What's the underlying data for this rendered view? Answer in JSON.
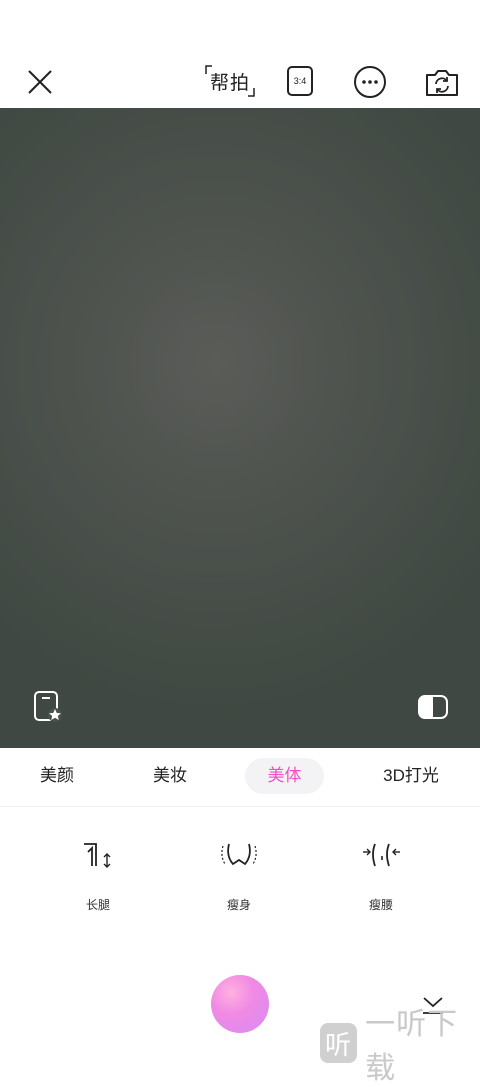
{
  "topbar": {
    "help_label": "帮拍",
    "ratio_label": "3:4",
    "icons": [
      "close-icon",
      "ratio-icon",
      "more-icon",
      "camera-switch-icon"
    ]
  },
  "overlay": {
    "icons": [
      "favorite-frame-icon",
      "compare-icon"
    ]
  },
  "tabs": [
    {
      "label": "美颜",
      "active": false
    },
    {
      "label": "美妆",
      "active": false
    },
    {
      "label": "美体",
      "active": true
    },
    {
      "label": "3D打光",
      "active": false
    }
  ],
  "features": [
    {
      "label": "长腿",
      "icon": "long-legs-icon"
    },
    {
      "label": "瘦身",
      "icon": "slim-body-icon"
    },
    {
      "label": "瘦腰",
      "icon": "slim-waist-icon"
    }
  ],
  "bottom": {
    "icons": [
      "shutter-button",
      "collapse-icon"
    ]
  },
  "watermark": {
    "logo_char": "听",
    "text": "一听下载"
  },
  "colors": {
    "accent": "#f04fc0",
    "viewfinder": "#4d524d"
  }
}
